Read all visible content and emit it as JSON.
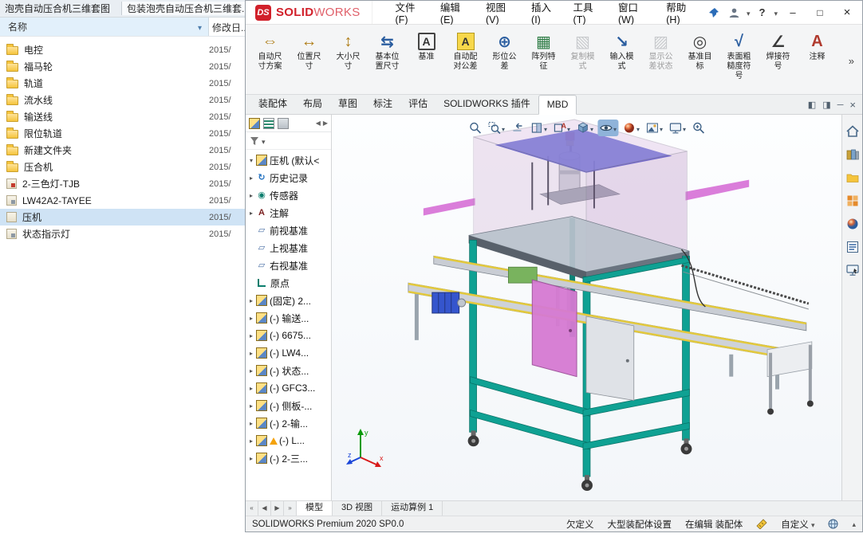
{
  "colors": {
    "brand_red": "#d1202a",
    "selection_blue": "#cfe3f5",
    "frame_teal": "#0fa193",
    "hood_pink": "#d6a8d8",
    "conveyor_yellow": "#e3c93c"
  },
  "explorer": {
    "window_titles": [
      "泡壳自动压合机三维套图",
      "包装泡壳自动压合机三维套..."
    ],
    "columns": {
      "name": "名称",
      "date": "修改日..."
    },
    "items": [
      {
        "label": "电控",
        "type": "folder",
        "date": "2015/"
      },
      {
        "label": "福马轮",
        "type": "folder",
        "date": "2015/"
      },
      {
        "label": "轨道",
        "type": "folder",
        "date": "2015/"
      },
      {
        "label": "流水线",
        "type": "folder",
        "date": "2015/"
      },
      {
        "label": "输送线",
        "type": "folder",
        "date": "2015/"
      },
      {
        "label": "限位轨道",
        "type": "folder",
        "date": "2015/"
      },
      {
        "label": "新建文件夹",
        "type": "folder",
        "date": "2015/"
      },
      {
        "label": "压合机",
        "type": "folder",
        "date": "2015/"
      },
      {
        "label": "2-三色灯-TJB",
        "type": "part",
        "date": "2015/"
      },
      {
        "label": "LW42A2-TAYEE",
        "type": "part",
        "date": "2015/"
      },
      {
        "label": "压机",
        "type": "part",
        "date": "2015/",
        "selected": true
      },
      {
        "label": "状态指示灯",
        "type": "part",
        "date": "2015/"
      }
    ]
  },
  "solidworks": {
    "brand": {
      "mark": "DS",
      "bold": "SOLID",
      "light": "WORKS"
    },
    "menus": [
      "文件(F)",
      "编辑(E)",
      "视图(V)",
      "插入(I)",
      "工具(T)",
      "窗口(W)",
      "帮助(H)"
    ],
    "toolbar": [
      {
        "label": "自动尺寸方案",
        "glyph": "⇔",
        "icon": "auto-dimension-scheme-icon"
      },
      {
        "label": "位置尺寸",
        "glyph": "↔",
        "icon": "location-dimension-icon"
      },
      {
        "label": "大小尺寸",
        "glyph": "↕",
        "icon": "size-dimension-icon"
      },
      {
        "label": "基本位置尺寸",
        "glyph": "⇆",
        "icon": "basic-location-dimension-icon"
      },
      {
        "label": "基准",
        "glyph": "A",
        "icon": "datum-icon"
      },
      {
        "label": "自动配对公差",
        "glyph": "A",
        "icon": "auto-mate-tolerance-icon"
      },
      {
        "label": "形位公差",
        "glyph": "⊕",
        "icon": "geometric-tolerance-icon"
      },
      {
        "label": "阵列特征",
        "glyph": "▦",
        "icon": "pattern-feature-icon"
      },
      {
        "label": "复制模式",
        "glyph": "▧",
        "icon": "copy-scheme-icon",
        "disabled": true
      },
      {
        "label": "输入模式",
        "glyph": "↘",
        "icon": "import-scheme-icon"
      },
      {
        "label": "显示公差状态",
        "glyph": "▨",
        "icon": "tolerance-status-icon",
        "disabled": true
      },
      {
        "label": "基准目标",
        "glyph": "◎",
        "icon": "datum-target-icon"
      },
      {
        "label": "表面粗糙度符号",
        "glyph": "√",
        "icon": "surface-finish-icon"
      },
      {
        "label": "焊接符号",
        "glyph": "∠",
        "icon": "weld-symbol-icon"
      },
      {
        "label": "注释",
        "glyph": "A",
        "icon": "note-icon"
      }
    ],
    "tabs": [
      "装配体",
      "布局",
      "草图",
      "标注",
      "评估",
      "SOLIDWORKS 插件",
      "MBD"
    ],
    "active_tab": "MBD",
    "tree": {
      "tab_icons": [
        "featuremanager",
        "propertymanager",
        "configurationmanager"
      ],
      "items": [
        {
          "label": "压机 (默认<",
          "arrow": "▾",
          "icon": "assembly"
        },
        {
          "label": "历史记录",
          "arrow": "▸",
          "icon": "history"
        },
        {
          "label": "传感器",
          "arrow": "▸",
          "icon": "sensor"
        },
        {
          "label": "注解",
          "arrow": "▸",
          "icon": "note"
        },
        {
          "label": "前视基准",
          "arrow": "",
          "icon": "plane"
        },
        {
          "label": "上视基准",
          "arrow": "",
          "icon": "plane"
        },
        {
          "label": "右视基准",
          "arrow": "",
          "icon": "plane"
        },
        {
          "label": "原点",
          "arrow": "",
          "icon": "origin"
        },
        {
          "label": "(固定) 2...",
          "arrow": "▸",
          "icon": "component"
        },
        {
          "label": "(-) 输送...",
          "arrow": "▸",
          "icon": "component"
        },
        {
          "label": "(-) 6675...",
          "arrow": "▸",
          "icon": "component"
        },
        {
          "label": "(-) LW4...",
          "arrow": "▸",
          "icon": "component"
        },
        {
          "label": "(-) 状态...",
          "arrow": "▸",
          "icon": "component"
        },
        {
          "label": "(-) GFC3...",
          "arrow": "▸",
          "icon": "component"
        },
        {
          "label": "(-) 侧板-...",
          "arrow": "▸",
          "icon": "component"
        },
        {
          "label": "(-) 2-输...",
          "arrow": "▸",
          "icon": "component"
        },
        {
          "label": "(-) L...",
          "arrow": "▸",
          "icon": "component",
          "warning": true
        },
        {
          "label": "(-) 2-三...",
          "arrow": "▸",
          "icon": "component"
        }
      ]
    },
    "headsup_icons": [
      "zoom-fit",
      "zoom-area",
      "previous-view",
      "section-view",
      "dynamic-annotation-views",
      "display-style",
      "hide-show-items",
      "edit-appearance",
      "apply-scene",
      "view-settings",
      "magnified-selection"
    ],
    "taskpane_icons": [
      "solidworks-resources",
      "design-library",
      "file-explorer",
      "view-palette",
      "appearances-scenes",
      "custom-properties",
      "solidworks-forum"
    ],
    "bottom_tabs": [
      "模型",
      "3D 视图",
      "运动算例 1"
    ],
    "status": {
      "version": "SOLIDWORKS Premium 2020 SP0.0",
      "constraint": "欠定义",
      "large_assembly": "大型装配体设置",
      "editing": "在编辑 装配体",
      "units": "自定义"
    }
  }
}
